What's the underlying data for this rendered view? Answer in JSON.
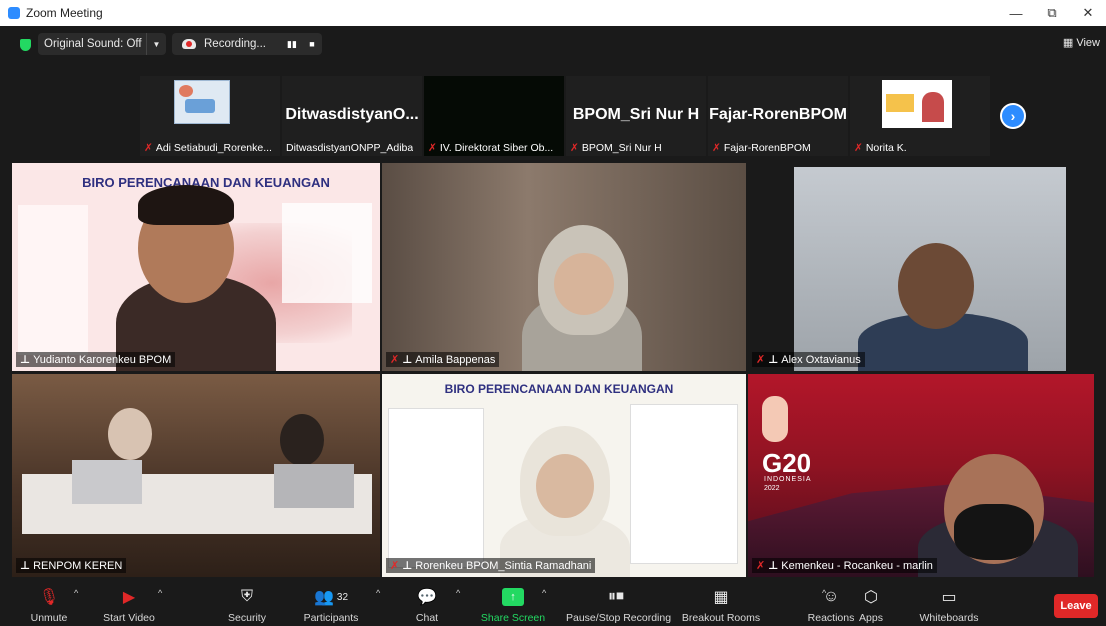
{
  "window": {
    "title": "Zoom Meeting",
    "minimize": "—",
    "restore": "⧉",
    "close": "✕"
  },
  "topbar": {
    "original_sound": "Original Sound: Off",
    "recording": "Recording...",
    "pause_icon": "▮▮",
    "stop_icon": "■",
    "view_label": "View"
  },
  "thumbnails": [
    {
      "caption": "Adi Setiabudi_Rorenke...",
      "big_name": "",
      "muted": true
    },
    {
      "caption": "DitwasdistyanONPP_Adiba",
      "big_name": "DitwasdistyanO...",
      "muted": false
    },
    {
      "caption": "IV. Direktorat Siber Ob...",
      "big_name": "",
      "muted": true
    },
    {
      "caption": "BPOM_Sri Nur H",
      "big_name": "BPOM_Sri Nur H",
      "muted": true
    },
    {
      "caption": "Fajar-RorenBPOM",
      "big_name": "Fajar-RorenBPOM",
      "muted": true
    },
    {
      "caption": "Norita K.",
      "big_name": "",
      "muted": true
    }
  ],
  "tiles": [
    {
      "label": "Yudianto Karorenkeu BPOM",
      "muted": false,
      "pinned": true
    },
    {
      "label": "Amila Bappenas",
      "muted": true,
      "pinned": true
    },
    {
      "label": "Alex Oxtavianus",
      "muted": true,
      "pinned": true
    },
    {
      "label": "RENPOM KEREN",
      "muted": false,
      "pinned": true
    },
    {
      "label": "Rorenkeu BPOM_Sintia Ramadhani",
      "muted": true,
      "pinned": true
    },
    {
      "label": "Kemenkeu - Rocankeu - marlin",
      "muted": true,
      "pinned": true
    }
  ],
  "slide": {
    "title": "BIRO PERENCANAAN DAN KEUANGAN"
  },
  "g20": {
    "logo_text": "G20",
    "country": "INDONESIA",
    "year": "2022"
  },
  "toolbar": {
    "unmute": "Unmute",
    "start_video": "Start Video",
    "security": "Security",
    "participants": "Participants",
    "participants_count": "32",
    "chat": "Chat",
    "share_screen": "Share Screen",
    "pause_stop_recording": "Pause/Stop Recording",
    "breakout_rooms": "Breakout Rooms",
    "reactions": "Reactions",
    "apps": "Apps",
    "whiteboards": "Whiteboards",
    "leave": "Leave"
  },
  "colors": {
    "accent": "#2d8cff",
    "active_speaker": "#b8e04b",
    "leave": "#e02828",
    "share": "#23d962"
  }
}
